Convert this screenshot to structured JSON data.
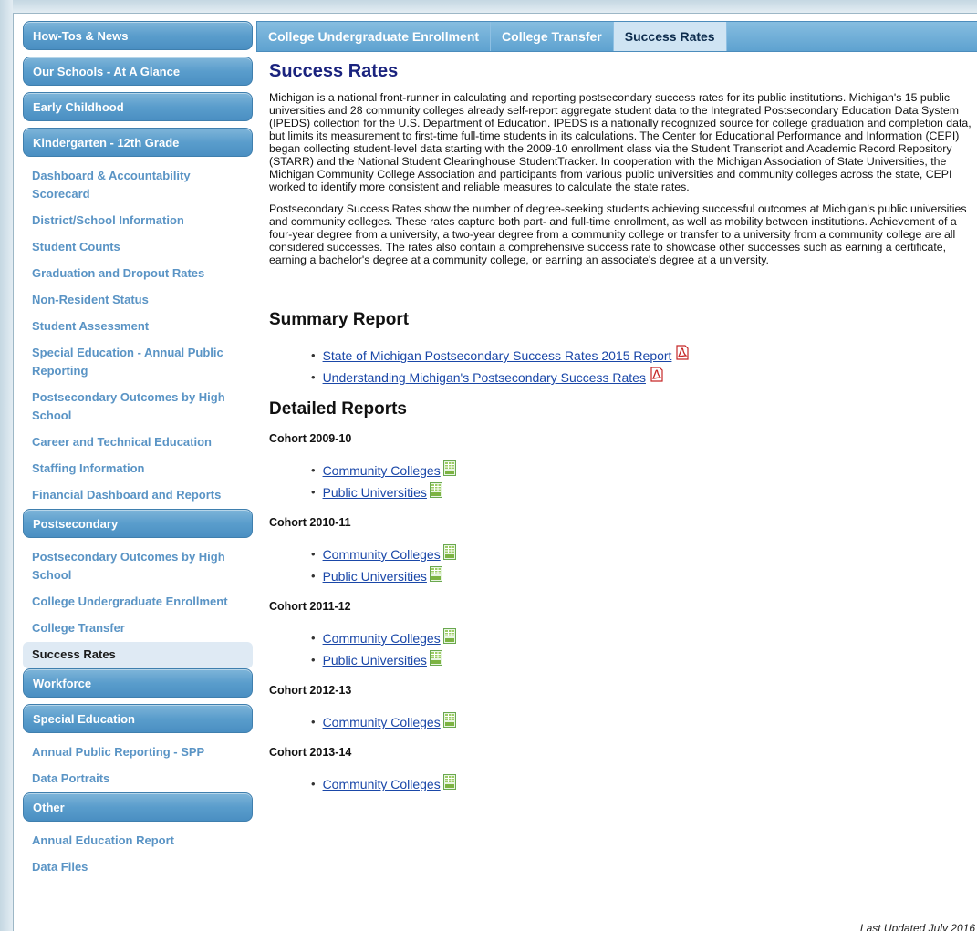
{
  "sidebar": {
    "items": [
      {
        "type": "cat",
        "label": "How-Tos & News"
      },
      {
        "type": "cat",
        "label": "Our Schools - At A Glance"
      },
      {
        "type": "cat",
        "label": "Early Childhood"
      },
      {
        "type": "cat",
        "label": "Kindergarten - 12th Grade"
      },
      {
        "type": "sub",
        "label": "Dashboard & Accountability Scorecard"
      },
      {
        "type": "sub",
        "label": "District/School Information"
      },
      {
        "type": "sub",
        "label": "Student Counts"
      },
      {
        "type": "sub",
        "label": "Graduation and Dropout Rates"
      },
      {
        "type": "sub",
        "label": "Non-Resident Status"
      },
      {
        "type": "sub",
        "label": "Student Assessment"
      },
      {
        "type": "sub",
        "label": "Special Education - Annual Public Reporting"
      },
      {
        "type": "sub",
        "label": "Postsecondary Outcomes by High School"
      },
      {
        "type": "sub",
        "label": "Career and Technical Education"
      },
      {
        "type": "sub",
        "label": "Staffing Information"
      },
      {
        "type": "sub",
        "label": "Financial Dashboard and Reports"
      },
      {
        "type": "cat",
        "label": "Postsecondary"
      },
      {
        "type": "sub",
        "label": "Postsecondary Outcomes by High School"
      },
      {
        "type": "sub",
        "label": "College Undergraduate Enrollment"
      },
      {
        "type": "sub",
        "label": "College Transfer"
      },
      {
        "type": "sub",
        "label": "Success Rates",
        "active": true
      },
      {
        "type": "cat",
        "label": "Workforce"
      },
      {
        "type": "cat",
        "label": "Special Education"
      },
      {
        "type": "sub",
        "label": "Annual Public Reporting - SPP"
      },
      {
        "type": "sub",
        "label": "Data Portraits"
      },
      {
        "type": "cat",
        "label": "Other"
      },
      {
        "type": "sub",
        "label": "Annual Education Report"
      },
      {
        "type": "sub",
        "label": "Data Files"
      }
    ]
  },
  "tabs": [
    {
      "label": "College Undergraduate Enrollment"
    },
    {
      "label": "College Transfer"
    },
    {
      "label": "Success Rates",
      "active": true
    }
  ],
  "main": {
    "title": "Success Rates",
    "para1": "Michigan is a national front-runner in calculating and reporting postsecondary success rates for its public institutions. Michigan's 15 public universities and 28 community colleges already self-report aggregate student data to the Integrated Postsecondary Education Data System (IPEDS) collection for the U.S. Department of Education. IPEDS is a nationally recognized source for college graduation and completion data, but limits its measurement to first-time full-time students in its calculations. The Center for Educational Performance and Information (CEPI) began collecting student-level data starting with the 2009-10 enrollment class via the Student Transcript and Academic Record Repository (STARR) and the National Student Clearinghouse StudentTracker. In cooperation with the Michigan Association of State Universities, the Michigan Community College Association and participants from various public universities and community colleges across the state, CEPI worked to identify more consistent and reliable measures to calculate the state rates.",
    "para2": "Postsecondary Success Rates show the number of degree-seeking students achieving successful outcomes at Michigan's public universities and community colleges. These rates capture both part- and full-time enrollment, as well as mobility between institutions. Achievement of a four-year degree from a university, a two-year degree from a community college or transfer to a university from a community college are all considered successes. The rates also contain a comprehensive success rate to showcase other successes such as earning a certificate, earning a bachelor's degree at a community college, or earning an associate's degree at a university.",
    "summary_heading": "Summary Report",
    "summary_links": [
      "State of Michigan Postsecondary Success Rates 2015 Report",
      "Understanding Michigan's Postsecondary Success Rates"
    ],
    "detailed_heading": "Detailed Reports",
    "cohorts": [
      {
        "label": "Cohort 2009-10",
        "links": [
          "Community Colleges",
          "Public Universities"
        ]
      },
      {
        "label": "Cohort 2010-11",
        "links": [
          "Community Colleges",
          "Public Universities"
        ]
      },
      {
        "label": "Cohort 2011-12",
        "links": [
          "Community Colleges",
          "Public Universities"
        ]
      },
      {
        "label": "Cohort 2012-13",
        "links": [
          "Community Colleges"
        ]
      },
      {
        "label": "Cohort 2013-14",
        "links": [
          "Community Colleges"
        ]
      }
    ],
    "updated": "Last Updated July 2016",
    "icons": {
      "pdf": "pdf-icon",
      "xls": "excel-icon"
    }
  }
}
